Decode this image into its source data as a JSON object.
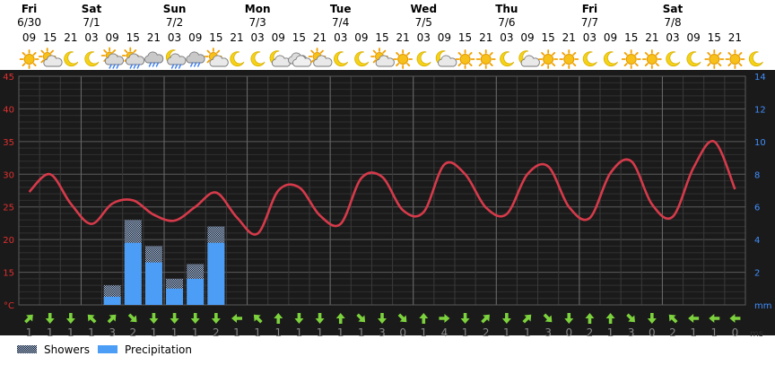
{
  "days": [
    {
      "name": "Fri",
      "date": "6/30",
      "hours": [
        "09",
        "15",
        "21"
      ]
    },
    {
      "name": "Sat",
      "date": "7/1",
      "hours": [
        "03",
        "09",
        "15",
        "21"
      ]
    },
    {
      "name": "Sun",
      "date": "7/2",
      "hours": [
        "03",
        "09",
        "15",
        "21"
      ]
    },
    {
      "name": "Mon",
      "date": "7/3",
      "hours": [
        "03",
        "09",
        "15",
        "21"
      ]
    },
    {
      "name": "Tue",
      "date": "7/4",
      "hours": [
        "03",
        "09",
        "15",
        "21"
      ]
    },
    {
      "name": "Wed",
      "date": "7/5",
      "hours": [
        "03",
        "09",
        "15",
        "21"
      ]
    },
    {
      "name": "Thu",
      "date": "7/6",
      "hours": [
        "03",
        "09",
        "15",
        "21"
      ]
    },
    {
      "name": "Fri",
      "date": "7/7",
      "hours": [
        "03",
        "09",
        "15",
        "21"
      ]
    },
    {
      "name": "Sat",
      "date": "7/8",
      "hours": [
        "03",
        "09",
        "15",
        "21"
      ]
    }
  ],
  "weather_icons": [
    "sun",
    "sun-cloud",
    "moon",
    "moon",
    "sun-cloud-rain",
    "sun-cloud-rain",
    "cloud-rain",
    "moon-cloud-rain",
    "cloud-rain",
    "sun-cloud",
    "moon",
    "moon",
    "moon-cloud",
    "cloud",
    "sun-cloud",
    "moon",
    "moon",
    "sun-cloud",
    "sun",
    "moon",
    "moon-cloud",
    "sun",
    "sun",
    "moon",
    "moon-cloud",
    "sun",
    "sun",
    "moon",
    "moon",
    "sun",
    "sun",
    "moon",
    "moon",
    "sun",
    "sun",
    "moon"
  ],
  "wind_arrows": [
    "ne",
    "s",
    "s",
    "nw",
    "ne",
    "se",
    "s",
    "s",
    "s",
    "s",
    "w",
    "nw",
    "n",
    "s",
    "s",
    "n",
    "se",
    "s",
    "se",
    "n",
    "e",
    "s",
    "ne",
    "s",
    "ne",
    "se",
    "s",
    "n",
    "n",
    "se",
    "s",
    "nw",
    "w",
    "w",
    "w"
  ],
  "wind_speeds": [
    "1",
    "1",
    "1",
    "1",
    "3",
    "2",
    "1",
    "1",
    "1",
    "2",
    "1",
    "1",
    "1",
    "1",
    "1",
    "1",
    "1",
    "3",
    "0",
    "1",
    "4",
    "1",
    "2",
    "1",
    "1",
    "3",
    "0",
    "2",
    "1",
    "3",
    "0",
    "2",
    "1",
    "1",
    "0"
  ],
  "wind_unit": "ms",
  "legend": {
    "showers": "Showers",
    "precipitation": "Precipitation"
  },
  "colors": {
    "temperature": "#d63a4a",
    "precipitation": "#4b9df5",
    "showers": "#8fb0de",
    "left_axis": "#e03030",
    "right_axis": "#3f8fff",
    "wind": "#7cd23c",
    "background": "#1a1a1a"
  },
  "chart_data": {
    "type": "line",
    "x": [
      "6/30 09",
      "6/30 15",
      "6/30 21",
      "7/1 03",
      "7/1 09",
      "7/1 15",
      "7/1 21",
      "7/2 03",
      "7/2 09",
      "7/2 15",
      "7/2 21",
      "7/3 03",
      "7/3 09",
      "7/3 15",
      "7/3 21",
      "7/4 03",
      "7/4 09",
      "7/4 15",
      "7/4 21",
      "7/5 03",
      "7/5 09",
      "7/5 15",
      "7/5 21",
      "7/6 03",
      "7/6 09",
      "7/6 15",
      "7/6 21",
      "7/7 03",
      "7/7 09",
      "7/7 15",
      "7/7 21",
      "7/8 03",
      "7/8 09",
      "7/8 15",
      "7/8 21"
    ],
    "series": [
      {
        "values": [
          27.3,
          30.0,
          25.5,
          22.4,
          25.5,
          26.0,
          23.8,
          22.9,
          25.0,
          27.2,
          23.4,
          20.9,
          27.5,
          28.0,
          23.7,
          22.4,
          29.4,
          29.6,
          24.5,
          24.2,
          31.5,
          30.0,
          24.9,
          23.9,
          30.0,
          31.2,
          25.0,
          23.3,
          30.2,
          32.0,
          25.4,
          23.5,
          31.0,
          35.0,
          27.7
        ]
      },
      {
        "values": [
          0,
          0,
          0,
          0,
          0.5,
          3.8,
          2.6,
          1.0,
          1.6,
          3.8,
          0,
          0,
          0,
          0,
          0,
          0,
          0,
          0,
          0,
          0,
          0,
          0,
          0,
          0,
          0,
          0,
          0,
          0,
          0,
          0,
          0,
          0,
          0,
          0,
          0
        ]
      },
      {
        "values": [
          0,
          0,
          0,
          0,
          1.2,
          5.2,
          3.6,
          1.6,
          2.5,
          4.8,
          0,
          0,
          0,
          0,
          0,
          0,
          0,
          0,
          0,
          0,
          0,
          0,
          0,
          0,
          0,
          0,
          0,
          0,
          0,
          0,
          0,
          0,
          0,
          0,
          0
        ]
      }
    ],
    "y_left": {
      "unit": "°C",
      "ticks": [
        "15",
        "20",
        "25",
        "30",
        "35",
        "40",
        "45"
      ],
      "range": [
        10,
        45
      ]
    },
    "y_right": {
      "unit": "mm",
      "ticks": [
        "2",
        "4",
        "6",
        "8",
        "10",
        "12",
        "14"
      ],
      "range": [
        0,
        14
      ]
    }
  }
}
